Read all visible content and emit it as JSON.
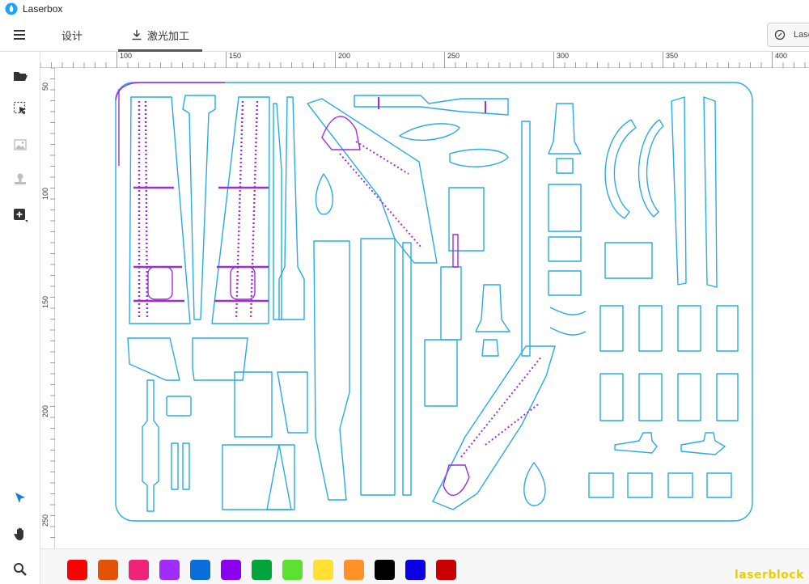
{
  "app": {
    "title": "Laserbox"
  },
  "tabs": {
    "design": "设计",
    "laser": "激光加工"
  },
  "device": {
    "label": "Laserbox"
  },
  "ruler": {
    "top": [
      "100",
      "150",
      "200",
      "250",
      "300",
      "350",
      "400"
    ],
    "left": [
      "50",
      "100",
      "150",
      "200",
      "250"
    ]
  },
  "palette": [
    "#ff0000",
    "#e35205",
    "#f0237a",
    "#a12cff",
    "#0a6fdc",
    "#8c00f0",
    "#00a43a",
    "#5ce132",
    "#ffe033",
    "#ff9126",
    "#000000",
    "#0a00e6",
    "#c80000"
  ],
  "colors": {
    "cut": "#29abe2",
    "engrave": "#9b2fdc"
  },
  "watermark": "laserblock"
}
